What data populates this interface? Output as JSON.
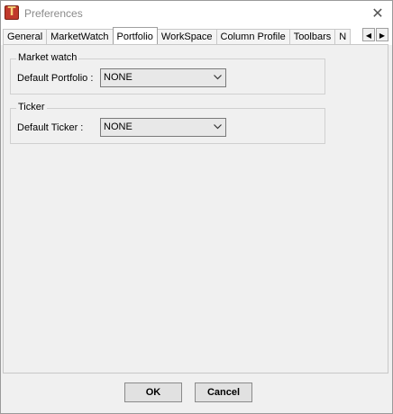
{
  "window": {
    "title": "Preferences",
    "app_icon_letter": "T"
  },
  "tabs": [
    {
      "label": "General",
      "active": false
    },
    {
      "label": "MarketWatch",
      "active": false
    },
    {
      "label": "Portfolio",
      "active": true
    },
    {
      "label": "WorkSpace",
      "active": false
    },
    {
      "label": "Column Profile",
      "active": false
    },
    {
      "label": "Toolbars",
      "active": false
    },
    {
      "label": "N",
      "active": false
    }
  ],
  "tab_scroll": {
    "left": "◀",
    "right": "▶"
  },
  "market_watch_group": {
    "title": "Market watch",
    "field_label": "Default Portfolio :",
    "value": "NONE"
  },
  "ticker_group": {
    "title": "Ticker",
    "field_label": "Default Ticker :",
    "value": "NONE"
  },
  "buttons": {
    "ok": "OK",
    "cancel": "Cancel"
  },
  "colors": {
    "app_icon": "#c0392b",
    "title_text": "#8a8a8a",
    "panel_bg": "#f0f0f0"
  }
}
